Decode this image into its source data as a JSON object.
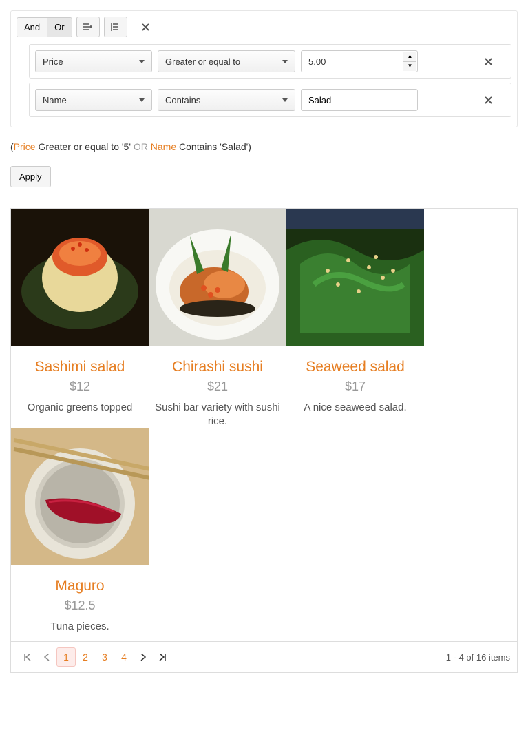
{
  "filter": {
    "logic": {
      "and": "And",
      "or": "Or",
      "active": "or"
    },
    "rows": [
      {
        "field": "Price",
        "operator": "Greater or equal to",
        "value": "5.00",
        "type": "number"
      },
      {
        "field": "Name",
        "operator": "Contains",
        "value": "Salad",
        "type": "text"
      }
    ],
    "expression": {
      "open": "(",
      "kw1": "Price",
      "txt1": " Greater or equal to '5' ",
      "or": "OR",
      "kw2": " Name",
      "txt2": " Contains 'Salad')",
      "close": ""
    },
    "apply": "Apply"
  },
  "items": [
    {
      "name": "Sashimi salad",
      "price": "$12",
      "desc": "Organic greens topped"
    },
    {
      "name": "Chirashi sushi",
      "price": "$21",
      "desc": "Sushi bar variety with sushi rice."
    },
    {
      "name": "Seaweed salad",
      "price": "$17",
      "desc": "A nice seaweed salad."
    },
    {
      "name": "Maguro",
      "price": "$12.5",
      "desc": "Tuna pieces."
    }
  ],
  "pager": {
    "pages": [
      "1",
      "2",
      "3",
      "4"
    ],
    "current": "1",
    "info": "1 - 4 of 16 items"
  }
}
